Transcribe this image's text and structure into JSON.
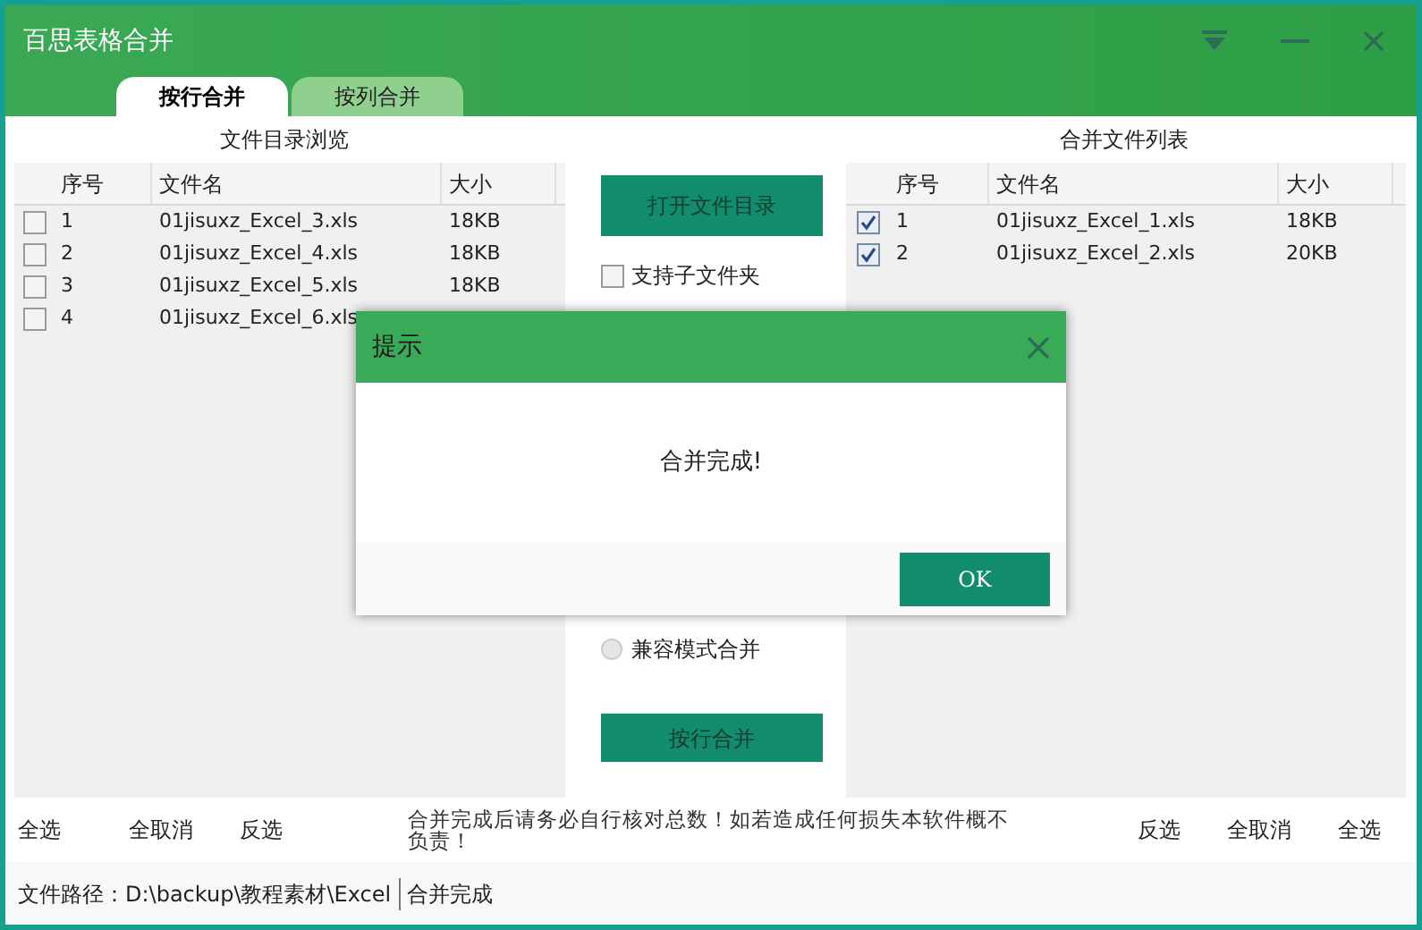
{
  "window": {
    "title": "百思表格合并"
  },
  "tabs": [
    {
      "label": "按行合并",
      "selected": true
    },
    {
      "label": "按列合并",
      "selected": false
    }
  ],
  "left_panel": {
    "title": "文件目录浏览",
    "columns": [
      "序号",
      "文件名",
      "大小"
    ],
    "rows": [
      {
        "checked": false,
        "cells": [
          "1",
          "01jisuxz_Excel_3.xls",
          "18KB"
        ]
      },
      {
        "checked": false,
        "cells": [
          "2",
          "01jisuxz_Excel_4.xls",
          "18KB"
        ]
      },
      {
        "checked": false,
        "cells": [
          "3",
          "01jisuxz_Excel_5.xls",
          "18KB"
        ]
      },
      {
        "checked": false,
        "cells": [
          "4",
          "01jisuxz_Excel_6.xls"
        ]
      }
    ]
  },
  "middle": {
    "open_button": "打开文件目录",
    "subfolder": {
      "label": "支持子文件夹",
      "checked": false
    },
    "compat": {
      "label": "兼容模式合并",
      "selected": false
    },
    "merge_button": "按行合并"
  },
  "right_panel": {
    "title": "合并文件列表",
    "columns": [
      "序号",
      "文件名",
      "大小"
    ],
    "rows": [
      {
        "checked": true,
        "cells": [
          "1",
          "01jisuxz_Excel_1.xls",
          "18KB"
        ]
      },
      {
        "checked": true,
        "cells": [
          "2",
          "01jisuxz_Excel_2.xls",
          "20KB"
        ]
      }
    ]
  },
  "left_actions": [
    "全选",
    "全取消",
    "反选"
  ],
  "notice": "合并完成后请务必自行核对总数！如若造成任何损失本软件概不负责！",
  "right_actions": [
    "反选",
    "全取消",
    "全选"
  ],
  "status_bar": {
    "path": "文件路径：D:\\backup\\教程素材\\Excel",
    "message": "合并完成"
  },
  "dialog": {
    "title": "提示",
    "message": "合并完成!",
    "ok": "OK"
  }
}
